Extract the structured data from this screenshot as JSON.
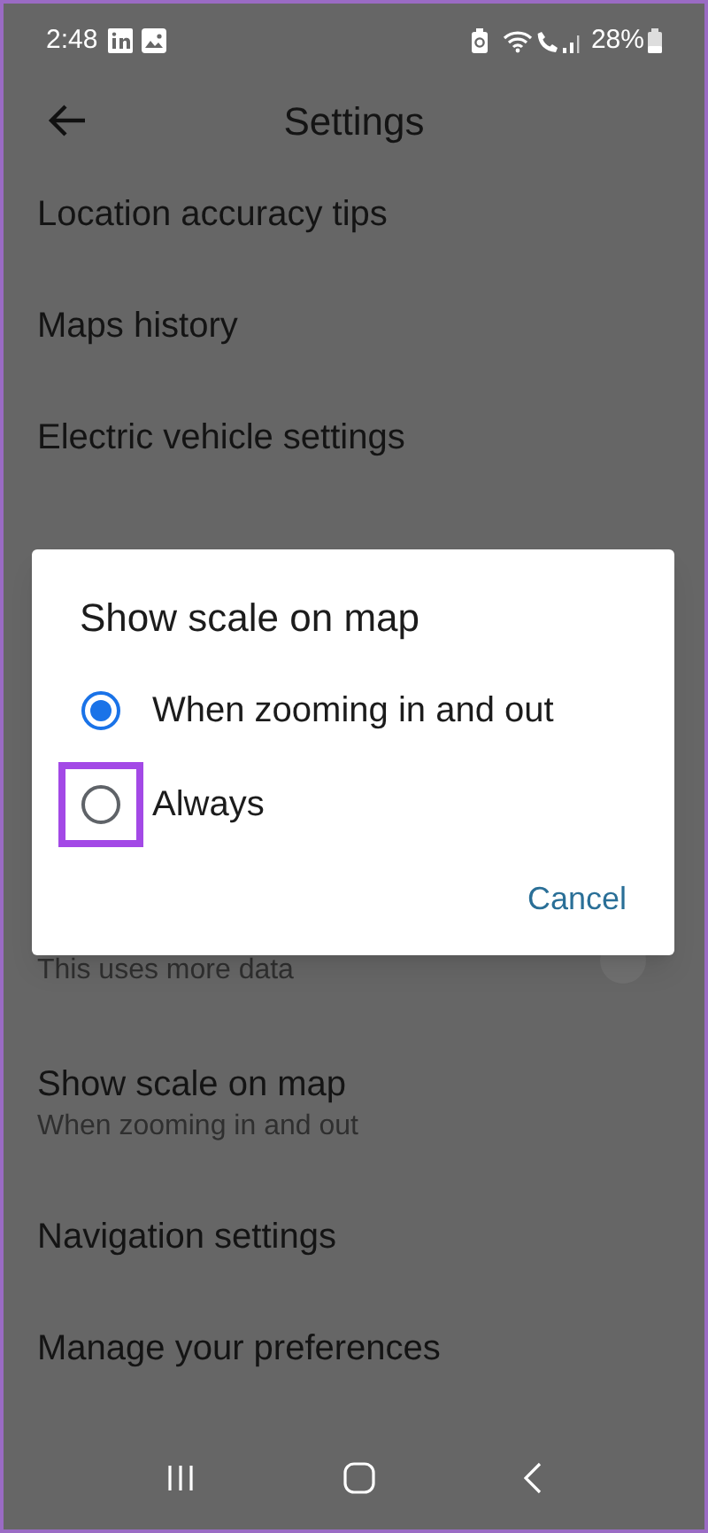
{
  "status_bar": {
    "time": "2:48",
    "battery": "28%"
  },
  "header": {
    "title": "Settings"
  },
  "settings": [
    {
      "title": "Location accuracy tips"
    },
    {
      "title": "Maps history"
    },
    {
      "title": "Electric vehicle settings"
    }
  ],
  "partial_row": {
    "subtitle": "This uses more data"
  },
  "settings_lower": [
    {
      "title": "Show scale on map",
      "subtitle": "When zooming in and out"
    },
    {
      "title": "Navigation settings"
    },
    {
      "title": "Manage your preferences"
    }
  ],
  "dialog": {
    "title": "Show scale on map",
    "options": [
      {
        "label": "When zooming in and out",
        "selected": true,
        "highlighted": false
      },
      {
        "label": "Always",
        "selected": false,
        "highlighted": true
      }
    ],
    "button": "Cancel"
  }
}
